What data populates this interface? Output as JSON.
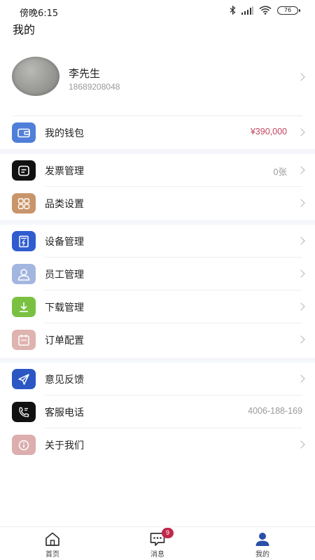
{
  "status_bar": {
    "time": "傍晚6:15",
    "battery": "76"
  },
  "header": {
    "title": "我的"
  },
  "profile": {
    "name": "李先生",
    "phone": "18689208048"
  },
  "menu": {
    "wallet": {
      "label": "我的钱包",
      "value": "¥390,000",
      "icon": "wallet-icon",
      "color": "#4f7fd8"
    },
    "invoice": {
      "label": "发票管理",
      "value": "0张",
      "icon": "invoice-icon",
      "color": "#111111"
    },
    "category": {
      "label": "品类设置",
      "icon": "grid-icon",
      "color": "#c8956a"
    },
    "device": {
      "label": "设备管理",
      "icon": "device-icon",
      "color": "#2f5ccf"
    },
    "staff": {
      "label": "员工管理",
      "icon": "user-icon",
      "color": "#a3b6df"
    },
    "download": {
      "label": "下载管理",
      "icon": "download-icon",
      "color": "#7ac142"
    },
    "order": {
      "label": "订单配置",
      "icon": "calendar-icon",
      "color": "#deb3b0"
    },
    "feedback": {
      "label": "意见反馈",
      "icon": "send-icon",
      "color": "#2a57c4"
    },
    "service": {
      "label": "客服电话",
      "value": "4006-188-169",
      "icon": "phone-icon",
      "color": "#111111"
    },
    "about": {
      "label": "关于我们",
      "icon": "info-icon",
      "color": "#dcaeae"
    }
  },
  "bottom_nav": {
    "home": {
      "label": "首页"
    },
    "messages": {
      "label": "消息",
      "badge": "9"
    },
    "mine": {
      "label": "我的"
    }
  }
}
